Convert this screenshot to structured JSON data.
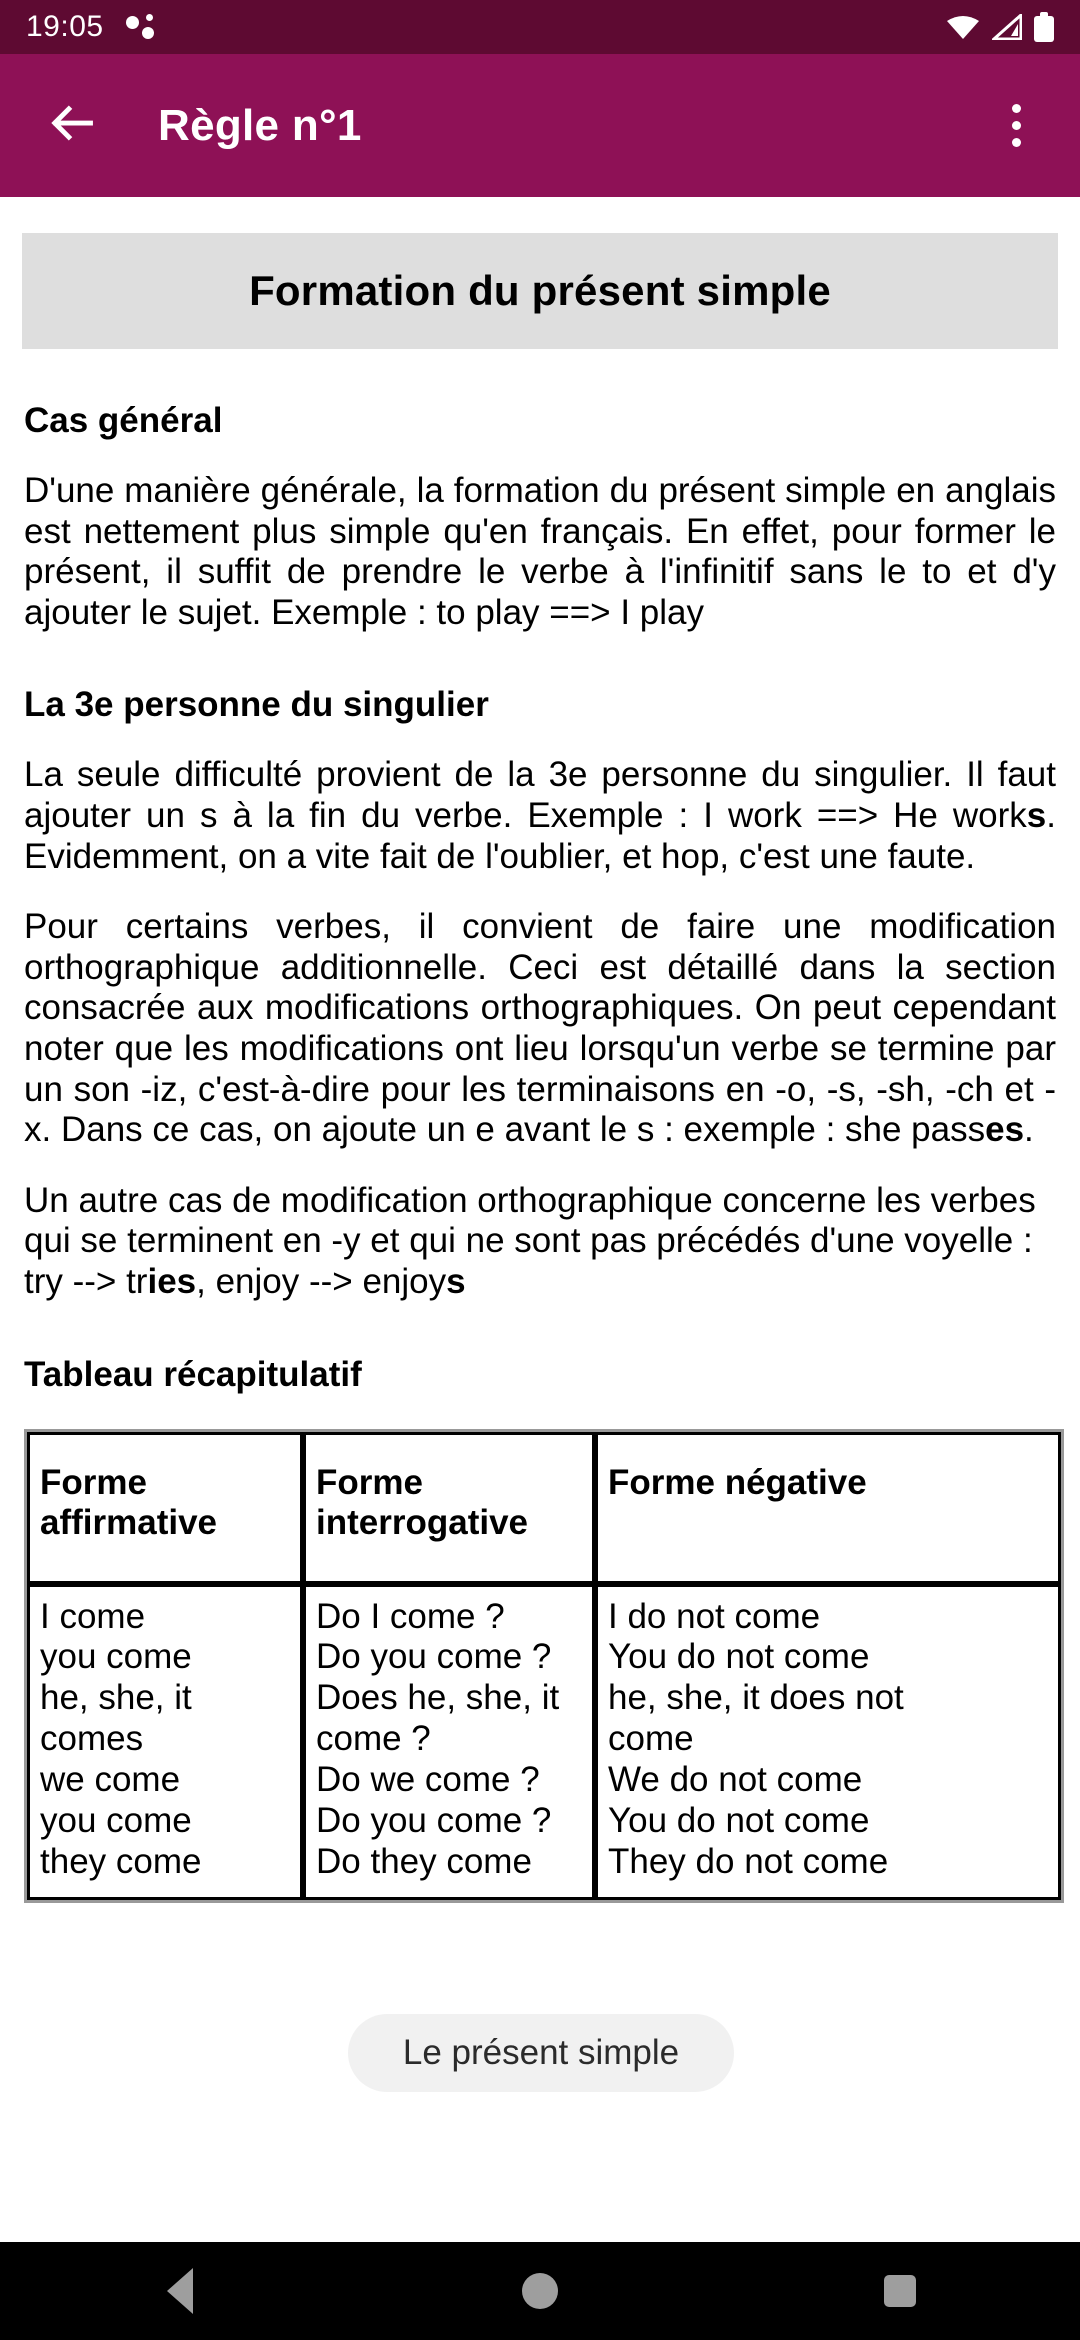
{
  "status_bar": {
    "time": "19:05",
    "icons": [
      "notification-dots-icon",
      "wifi-icon",
      "signal-icon",
      "battery-icon"
    ],
    "background_color": "#5E0A32"
  },
  "app_bar": {
    "back_label": "back-arrow",
    "title": "Règle n°1",
    "overflow_label": "more-options",
    "background_color": "#8E1156",
    "text_color": "#FFFFFF"
  },
  "page": {
    "banner_title": "Formation du présent simple",
    "banner_background": "#DEDEDE",
    "sections": [
      {
        "heading": "Cas général",
        "paragraphs": [
          "D'une manière générale, la formation du présent simple en anglais est nettement plus simple qu'en français. En effet, pour former le présent, il suffit de prendre le verbe à l'infinitif sans le to et d'y ajouter le sujet. Exemple : to play ==> I play"
        ]
      },
      {
        "heading": "La 3e personne du singulier",
        "paragraphs": [
          "La seule difficulté provient de la 3e personne du singulier. Il faut ajouter un s à la fin du verbe. Exemple : I work ==> He works. Evidemment, on a vite fait de l'oublier, et hop, c'est une faute.",
          "Pour certains verbes, il convient de faire une modification orthographique additionnelle. Ceci est détaillé dans la section consacrée aux modifications orthographiques. On peut cependant noter que les modifications ont lieu lorsqu'un verbe se termine par un son -iz, c'est-à-dire pour les terminaisons en -o, -s, -sh, -ch et -x. Dans ce cas, on ajoute un e avant le s : exemple : she passes.",
          "Un autre cas de modification orthographique concerne les verbes qui se terminent en -y et qui ne sont pas précédés d'une voyelle : try --> tries, enjoy --> enjoys"
        ]
      }
    ],
    "table_heading": "Tableau récapitulatif"
  },
  "table": {
    "headers": [
      "Forme affirmative",
      "Forme interrogative",
      "Forme négative"
    ],
    "rows": [
      {
        "affirmative": [
          "I come",
          "you come",
          "he, she, it",
          "comes",
          "we come",
          "you come",
          "they come"
        ],
        "interrogative": [
          "Do I come ?",
          "Do you come ?",
          "Does he, she, it",
          "come ?",
          "Do we come ?",
          "Do you come ?",
          "Do they come"
        ],
        "negative": [
          "I do not come",
          "You do not come",
          "he, she, it does not",
          "come",
          "We do not come",
          "You do not come",
          "They do not come"
        ]
      }
    ]
  },
  "toast": {
    "message": "Le présent simple"
  },
  "nav_bar": {
    "back": "back-triangle-icon",
    "home": "home-circle-icon",
    "recents": "recents-square-icon",
    "background_color": "#000000",
    "icon_color": "#9E9E9E"
  }
}
